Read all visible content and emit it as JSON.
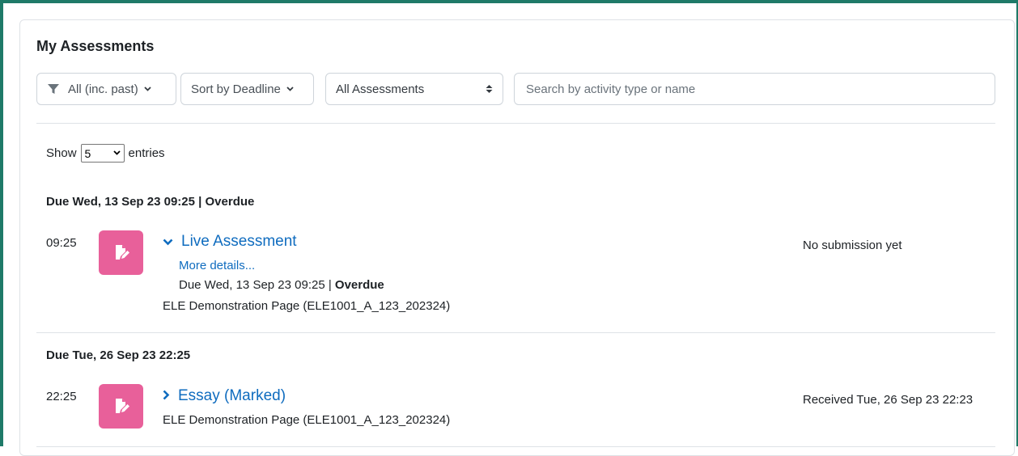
{
  "block": {
    "title": "My Assessments"
  },
  "filters": {
    "time_filter": "All (inc. past)",
    "sort": "Sort by Deadline",
    "type_select": "All Assessments",
    "search_placeholder": "Search by activity type or name"
  },
  "pagination": {
    "show_label": "Show",
    "entries_value": "5",
    "entries_label": "entries"
  },
  "groups": [
    {
      "heading_text": "Due Wed, 13 Sep 23 09:25 | ",
      "heading_flag": "Overdue",
      "item": {
        "time": "09:25",
        "title": "Live Assessment",
        "more_details": "More details...",
        "due_text": "Due Wed, 13 Sep 23 09:25 | ",
        "due_flag": "Overdue",
        "course": "ELE Demonstration Page (ELE1001_A_123_202324)",
        "status": "No submission yet"
      }
    },
    {
      "heading_text": "Due Tue, 26 Sep 23 22:25",
      "item": {
        "time": "22:25",
        "title": "Essay (Marked)",
        "course": "ELE Demonstration Page (ELE1001_A_123_202324)",
        "status": "Received Tue, 26 Sep 23 22:23"
      }
    }
  ],
  "colors": {
    "accent": "#0f6cbf",
    "icon_bg": "#e8609a",
    "frame": "#1f7a68"
  },
  "icons": {
    "filter": "filter-icon",
    "chevron_down": "chevron-down-icon",
    "chevron_right": "chevron-right-icon",
    "assignment": "assignment-icon"
  }
}
